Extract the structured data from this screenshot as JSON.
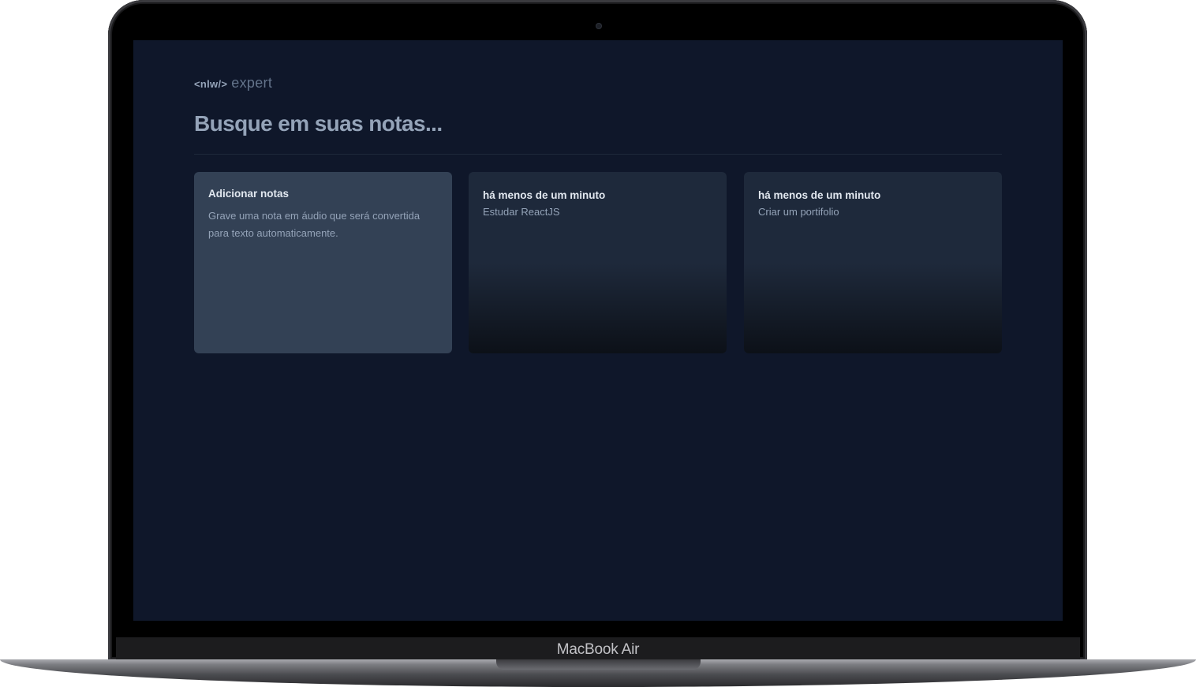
{
  "device": {
    "label": "MacBook Air"
  },
  "header": {
    "logo_tag": "<nlw/>",
    "logo_name": "expert"
  },
  "search": {
    "placeholder": "Busque em suas notas...",
    "value": ""
  },
  "add_card": {
    "title": "Adicionar notas",
    "description": "Grave uma nota em áudio que será convertida para texto automaticamente."
  },
  "notes": [
    {
      "date": "há menos de um minuto",
      "content": "Estudar ReactJS"
    },
    {
      "date": "há menos de um minuto",
      "content": "Criar um portifolio"
    }
  ],
  "colors": {
    "background": "#0f172a",
    "card_add": "#334155",
    "card_note": "#1e293b",
    "text_primary": "#e2e8f0",
    "text_muted": "#94a3b8"
  }
}
